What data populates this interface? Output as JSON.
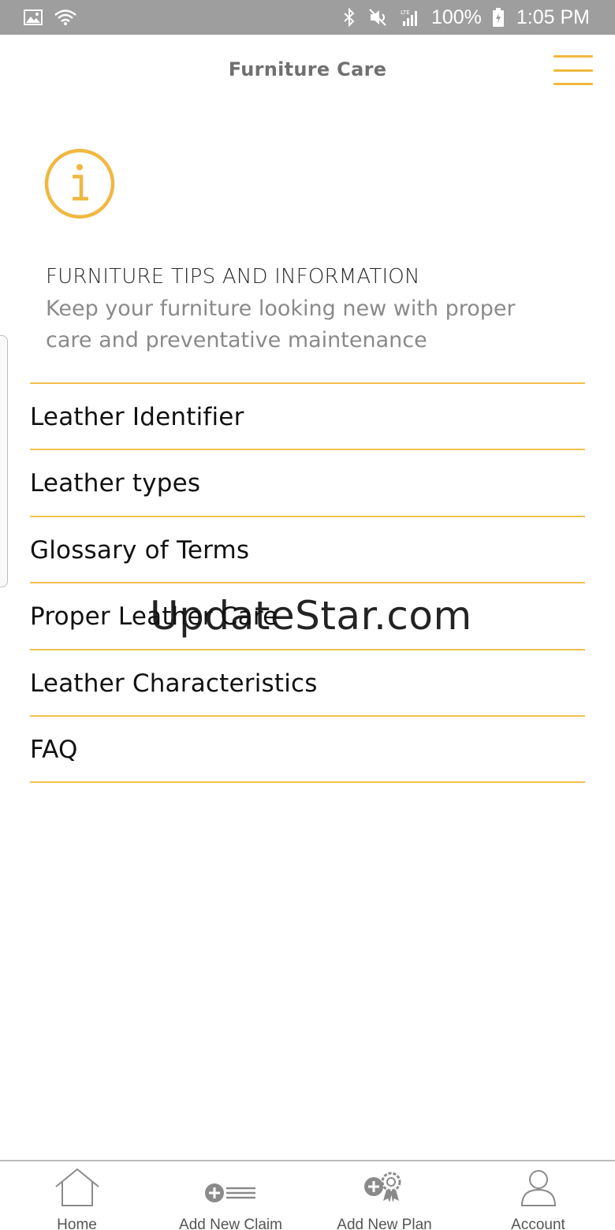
{
  "status_bar": {
    "battery": "100%",
    "time": "1:05 PM",
    "left_icons": [
      "image-icon",
      "wifi-icon"
    ],
    "right_icons": [
      "bluetooth-icon",
      "mute-icon",
      "lte-signal-icon",
      "battery-charging-icon"
    ]
  },
  "header": {
    "title": "Furniture Care",
    "menu_icon": "hamburger-menu-icon"
  },
  "intro": {
    "icon": "info-icon",
    "title": "FURNITURE TIPS AND INFORMATION",
    "subtitle": "Keep your furniture looking new with proper care and preventative maintenance"
  },
  "menu": {
    "items": [
      {
        "label": "Leather Identifier"
      },
      {
        "label": "Leather types"
      },
      {
        "label": "Glossary of Terms"
      },
      {
        "label": "Proper Leather Care"
      },
      {
        "label": "Leather Characteristics"
      },
      {
        "label": "FAQ"
      }
    ]
  },
  "watermark": "UpdateStar.com",
  "bottom_nav": {
    "items": [
      {
        "label": "Home",
        "icon": "home-icon"
      },
      {
        "label": "Add New Claim",
        "icon": "add-claim-icon"
      },
      {
        "label": "Add New Plan",
        "icon": "add-plan-icon"
      },
      {
        "label": "Account",
        "icon": "account-icon"
      }
    ]
  },
  "colors": {
    "accent": "#f0b840",
    "status_bar": "#9e9e9e",
    "title_gray": "#707070",
    "subtitle_gray": "#8a8a8a"
  }
}
